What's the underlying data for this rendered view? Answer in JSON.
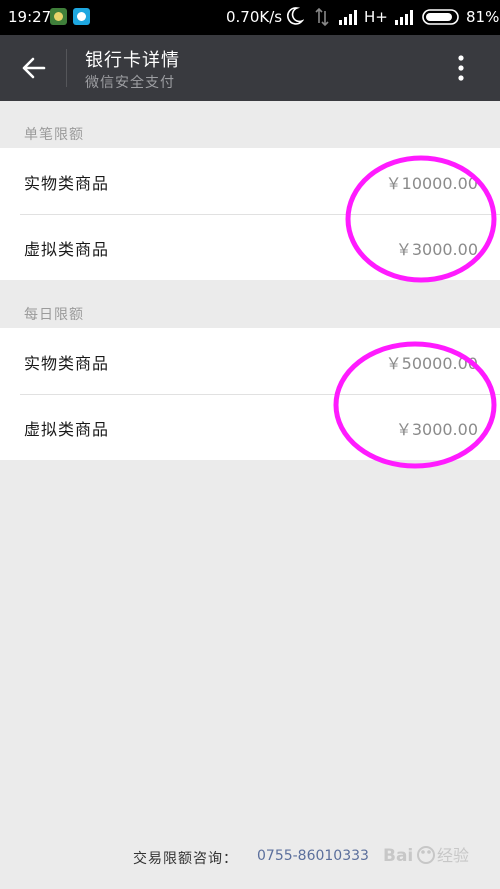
{
  "status_bar": {
    "time": "19:27",
    "network_speed": "0.70K/s",
    "network_type": "H+",
    "battery": "81%",
    "icons": [
      "app-icon",
      "app-icon",
      "moon-icon",
      "data-arrows-icon",
      "signal-icon",
      "signal-icon",
      "battery-icon"
    ]
  },
  "header": {
    "title": "银行卡详情",
    "subtitle": "微信安全支付",
    "back_icon": "back-arrow-icon",
    "more_icon": "more-vertical-icon"
  },
  "sections": [
    {
      "label": "单笔限额",
      "rows": [
        {
          "label": "实物类商品",
          "value": "￥10000.00"
        },
        {
          "label": "虚拟类商品",
          "value": "￥3000.00"
        }
      ]
    },
    {
      "label": "每日限额",
      "rows": [
        {
          "label": "实物类商品",
          "value": "￥50000.00"
        },
        {
          "label": "虚拟类商品",
          "value": "￥3000.00"
        }
      ]
    }
  ],
  "footer": {
    "label": "交易限额咨询：",
    "phone": "0755-86010333"
  },
  "annotation_color": "#ff1bff",
  "colors": {
    "header_bg": "#393a3f",
    "page_bg": "#ebebeb",
    "link": "#5b6f9c"
  }
}
